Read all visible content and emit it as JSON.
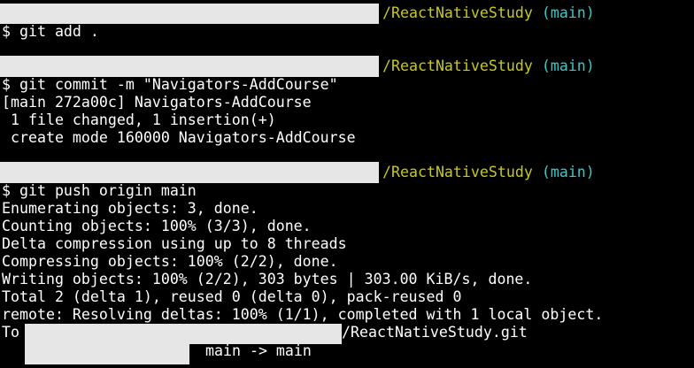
{
  "theme": {
    "background": "#000000",
    "text": "#ffffff",
    "path_color": "#c8c81e",
    "branch_color": "#3cc8c8",
    "redaction_color": "#e6e6e6"
  },
  "blocks": [
    {
      "prompt_path": "/ReactNativeStudy",
      "prompt_branch": "(main)",
      "command": "$ git add ."
    },
    {
      "prompt_path": "/ReactNativeStudy",
      "prompt_branch": "(main)",
      "command": "$ git commit -m \"Navigators-AddCourse\"",
      "output": [
        "[main 272a00c] Navigators-AddCourse",
        " 1 file changed, 1 insertion(+)",
        " create mode 160000 Navigators-AddCourse"
      ]
    },
    {
      "prompt_path": "/ReactNativeStudy",
      "prompt_branch": "(main)",
      "command": "$ git push origin main",
      "output": [
        "Enumerating objects: 3, done.",
        "Counting objects: 100% (3/3), done.",
        "Delta compression using up to 8 threads",
        "Compressing objects: 100% (2/2), done.",
        "Writing objects: 100% (2/2), 303 bytes | 303.00 KiB/s, done.",
        "Total 2 (delta 1), reused 0 (delta 0), pack-reused 0",
        "remote: Resolving deltas: 100% (1/1), completed with 1 local object."
      ],
      "to_prefix": "To",
      "to_suffix": "/ReactNativeStudy.git",
      "ref_update": "main -> main"
    }
  ]
}
